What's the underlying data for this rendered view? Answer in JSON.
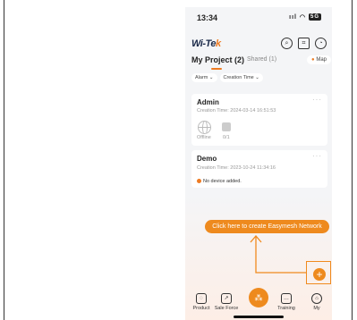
{
  "status": {
    "time": "13:34",
    "signal": "ııl",
    "wifi": "wifi",
    "battery": "5G"
  },
  "brand": {
    "prefix": "Wi-Te",
    "suffix": "k"
  },
  "header": {
    "icons": [
      "search-icon",
      "scan-icon",
      "bell-icon"
    ]
  },
  "tabs": {
    "my_project": "My Project (2)",
    "shared": "Shared (1)",
    "map": "Map"
  },
  "filters": {
    "alarm": "Alarm ⌄",
    "creation_time": "Creation Time ⌄"
  },
  "projects": [
    {
      "name": "Admin",
      "creation_time": "Creation Time: 2024-03-14 16:51:53",
      "status": "Offline",
      "count": "0/1"
    },
    {
      "name": "Demo",
      "creation_time": "Creation Time: 2023-10-24 11:34:16",
      "warning": "No device added."
    }
  ],
  "cta": {
    "label": "Click here to create Easymesh Network"
  },
  "fab": {
    "label": "+"
  },
  "nav": {
    "product": "Product",
    "sale_force": "Sale Force",
    "training": "Training",
    "my": "My"
  },
  "colors": {
    "accent": "#ee8a1e",
    "annotation": "#f08a1e"
  }
}
